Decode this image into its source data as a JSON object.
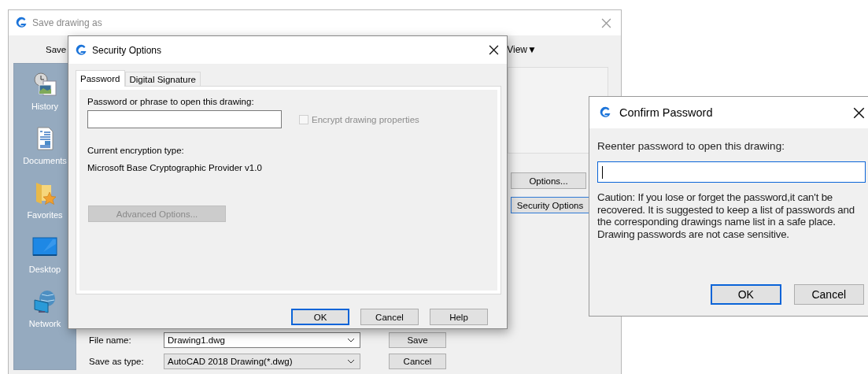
{
  "save_dialog": {
    "title": "Save drawing as",
    "save_in_label": "Save",
    "view_menu": {
      "label": "View",
      "caret": "▼"
    },
    "places": [
      {
        "label": "History",
        "kind": "history"
      },
      {
        "label": "Documents",
        "kind": "documents"
      },
      {
        "label": "Favorites",
        "kind": "favorites"
      },
      {
        "label": "Desktop",
        "kind": "desktop"
      },
      {
        "label": "Network",
        "kind": "network"
      }
    ],
    "side_buttons": [
      {
        "label": "Options..."
      },
      {
        "label": "Security Options"
      }
    ],
    "fields": [
      {
        "label": "File name:",
        "value": "Drawing1.dwg",
        "kind": "edit"
      },
      {
        "label": "Save as type:",
        "value": "AutoCAD 2018 Drawing(*.dwg)",
        "kind": "list"
      }
    ],
    "actions": [
      {
        "label": "Save"
      },
      {
        "label": "Cancel"
      }
    ]
  },
  "security_options": {
    "title": "Security Options",
    "tabs": [
      {
        "label": "Password",
        "selected": true
      },
      {
        "label": "Digital Signature",
        "selected": false
      }
    ],
    "password_label": "Password or phrase to open this drawing:",
    "encrypt_properties": {
      "label": "Encrypt drawing properties",
      "checked": false,
      "disabled": true
    },
    "encryption_type_label": "Current encryption type:",
    "encryption_type": "Microsoft Base Cryptographic Provider v1.0",
    "advanced_button": {
      "label": "Advanced Options...",
      "disabled": true
    },
    "buttons": [
      {
        "label": "OK",
        "default": true
      },
      {
        "label": "Cancel",
        "default": false
      },
      {
        "label": "Help",
        "default": false
      }
    ]
  },
  "confirm_password": {
    "title": "Confirm Password",
    "prompt": "Reenter password to open this drawing:",
    "field": {
      "focused": true
    },
    "caution": "Caution: If you lose or forget the password,it can't be recovered. It is suggested to keep a list of passwords and the corresponding drawings name list in a safe place. Drawing passwords are not case sensitive.",
    "buttons": [
      {
        "label": "OK",
        "default": true
      },
      {
        "label": "Cancel",
        "default": false
      }
    ]
  }
}
